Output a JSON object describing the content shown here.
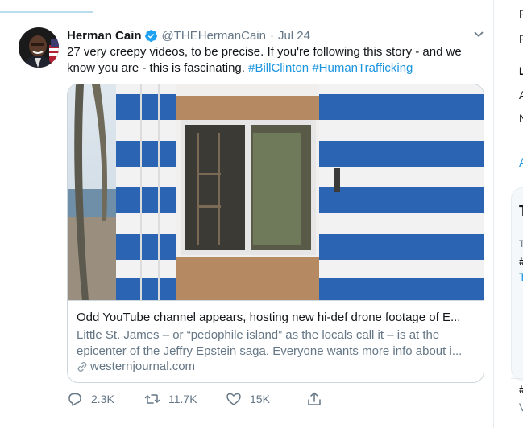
{
  "tweet": {
    "author_name": "Herman Cain",
    "author_handle": "@THEHermanCain",
    "separator": "·",
    "timestamp": "Jul 24",
    "text_plain": "27 very creepy videos, to be precise. If you're following this story - and we know you are - this is fascinating.",
    "hashtags": [
      "#BillClinton",
      "#HumanTrafficking"
    ],
    "card": {
      "title": "Odd YouTube channel appears, hosting new hi-def drone footage of E...",
      "desc_line1": "Little St. James – or “pedophile island” as the locals call it – is at the",
      "desc_line2": "epicenter of the Jeffry Epstein saga.  Everyone wants more info about i...",
      "domain": "westernjournal.com"
    },
    "actions": {
      "reply_count": "2.3K",
      "retweet_count": "11.7K",
      "like_count": "15K"
    }
  },
  "sidebar_fragments": [
    "F",
    "F",
    "L",
    "A",
    "N",
    "A",
    "T",
    "T",
    "#",
    "T",
    "#",
    "V"
  ],
  "icons": {
    "verified": "verified-badge-icon",
    "caret": "chevron-down-icon",
    "link": "link-icon",
    "reply": "reply-icon",
    "retweet": "retweet-icon",
    "like": "heart-icon",
    "share": "share-icon"
  },
  "colors": {
    "link_blue": "#1b95e0",
    "verified_blue": "#1da1f2",
    "secondary_text": "#657786",
    "border": "#ccd6dd"
  }
}
